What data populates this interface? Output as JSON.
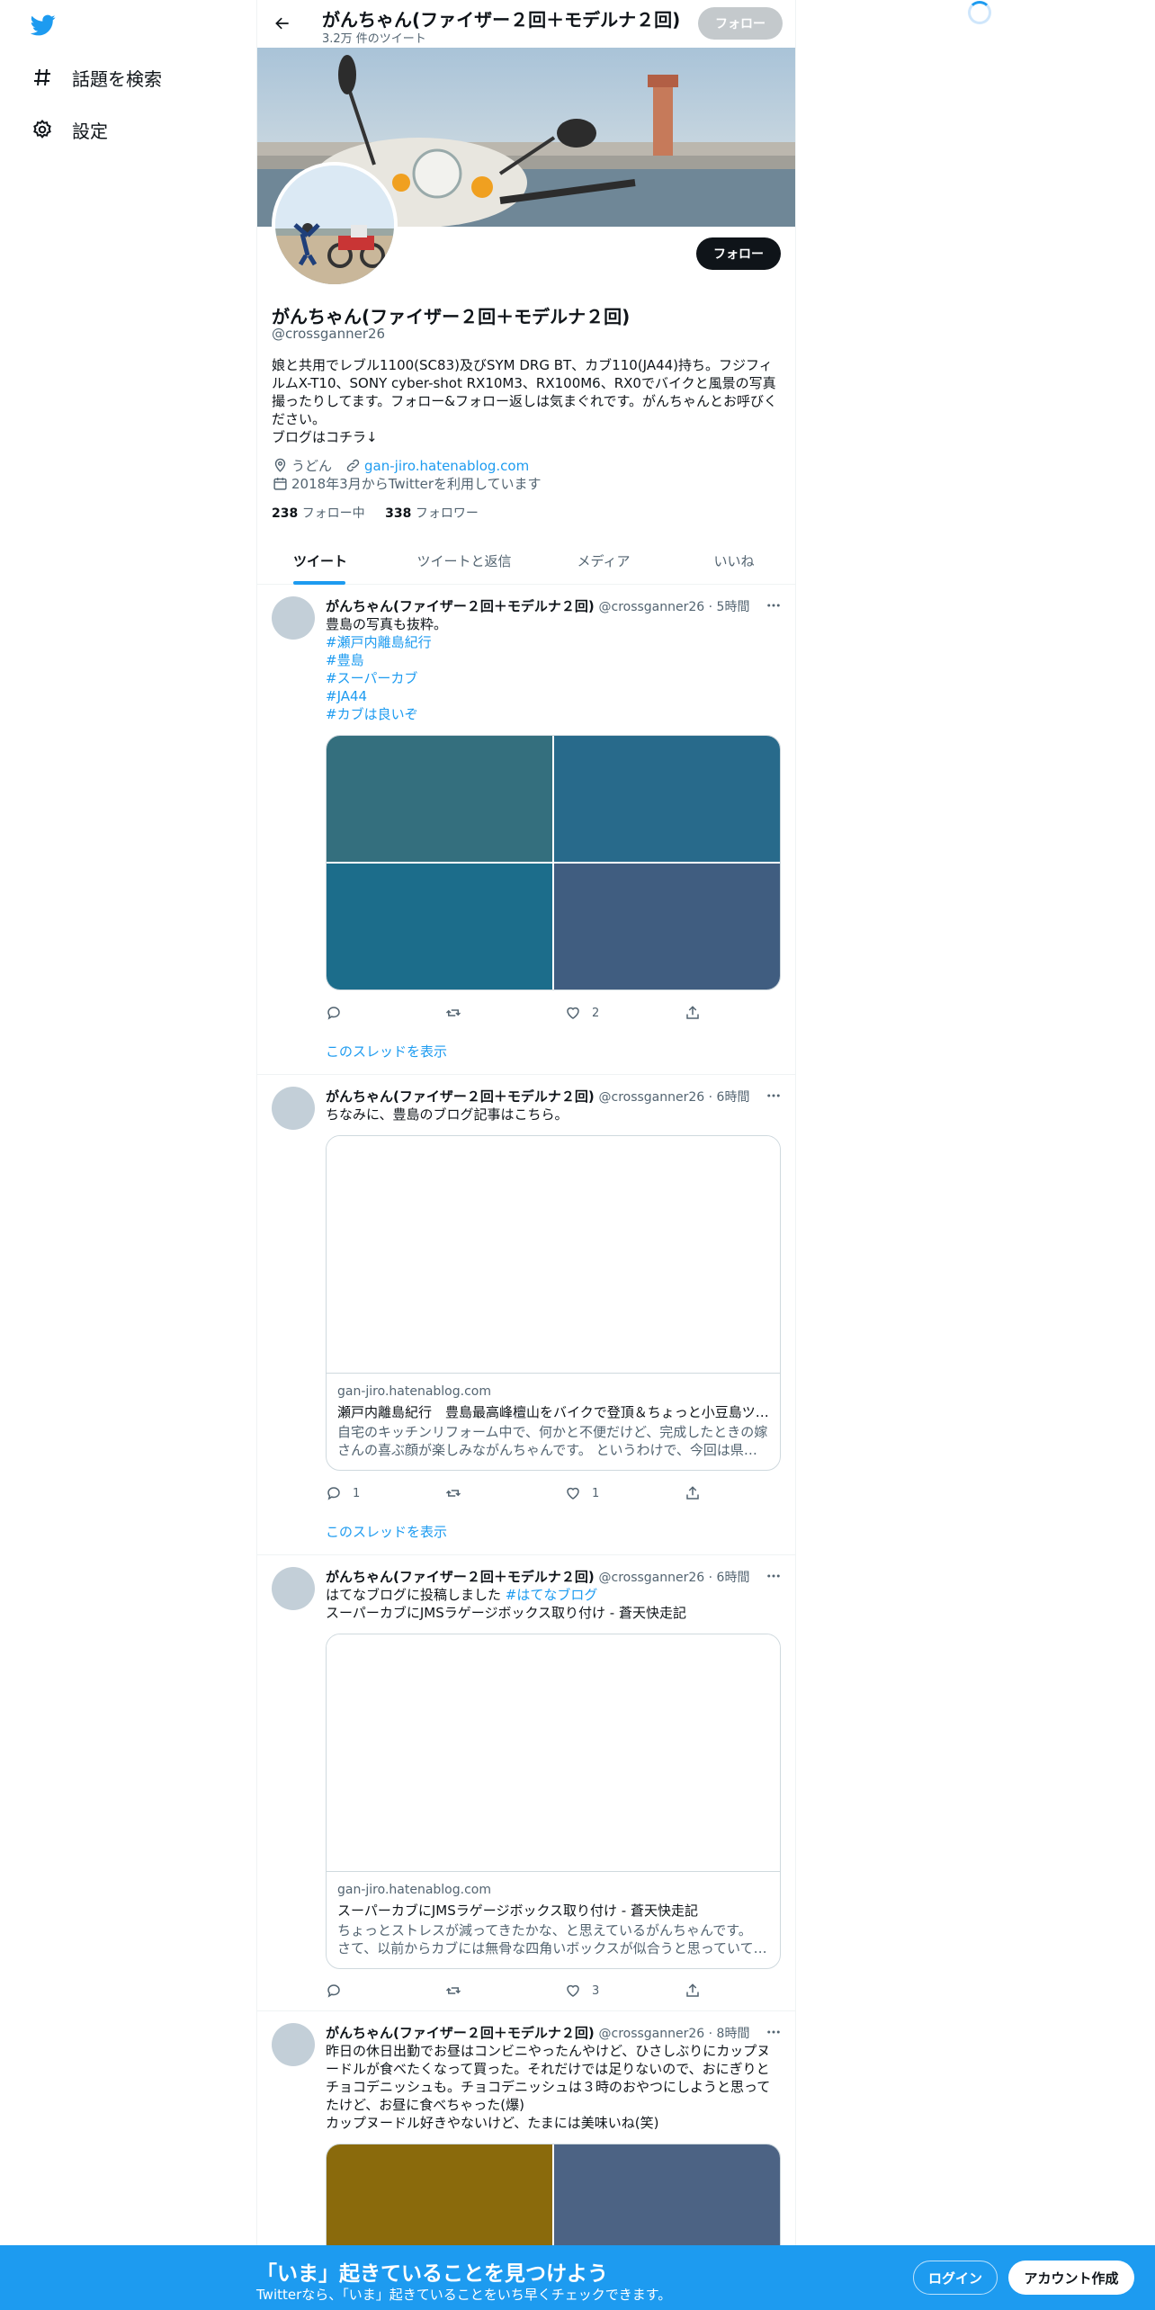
{
  "nav": {
    "explore_label": "話題を検索",
    "settings_label": "設定"
  },
  "colors": {
    "accent": "#1d9bf0",
    "text": "#0f1419",
    "muted": "#536471"
  },
  "header": {
    "name": "がんちゃん(ファイザー２回＋モデルナ２回)",
    "tweet_count": "3.2万 件のツイート",
    "follow_label": "フォロー"
  },
  "profile": {
    "name": "がんちゃん(ファイザー２回＋モデルナ２回)",
    "handle": "@crossganner26",
    "follow_label": "フォロー",
    "bio_line1": "娘と共用でレブル1100(SC83)及びSYM DRG BT、カブ110(JA44)持ち。フジフィルムX-T10、SONY  cyber-shot RX10M3、RX100M6、RX0でバイクと風景の写真撮ったりしてます。フォロー&フォロー返しは気まぐれです。がんちゃんとお呼びください。",
    "bio_line2": "ブログはコチラ↓",
    "location": "うどん",
    "website": "gan-jiro.hatenablog.com",
    "joined": "2018年3月からTwitterを利用しています",
    "following_count": "238",
    "following_label": "フォロー中",
    "followers_count": "338",
    "followers_label": "フォロワー"
  },
  "tabs": [
    {
      "label": "ツイート"
    },
    {
      "label": "ツイートと返信"
    },
    {
      "label": "メディア"
    },
    {
      "label": "いいね"
    }
  ],
  "tweets": [
    {
      "name": "がんちゃん(ファイザー２回＋モデルナ２回)",
      "handle": "@crossganner26 · 5時間",
      "text": "豊島の写真も抜粋。",
      "hashtags": [
        "#瀬戸内離島紀行",
        "#豊島",
        "#スーパーカブ",
        "#JA44",
        "#カブは良いぞ"
      ],
      "likes": "2",
      "thread": "このスレッドを表示"
    },
    {
      "name": "がんちゃん(ファイザー２回＋モデルナ２回)",
      "handle": "@crossganner26 · 6時間",
      "text": "ちなみに、豊島のブログ記事はこちら。",
      "card_domain": "gan-jiro.hatenablog.com",
      "card_title": "瀬戸内離島紀行　豊島最高峰檀山をバイクで登頂＆ちょっと小豆島ツーリング",
      "card_desc": "自宅のキッチンリフォーム中で、何かと不便だけど、完成したときの嫁さんの喜ぶ顔が楽しみながんちゃんです。 というわけで、今回は県…",
      "replies": "1",
      "likes": "1",
      "thread": "このスレッドを表示"
    },
    {
      "name": "がんちゃん(ファイザー２回＋モデルナ２回)",
      "handle": "@crossganner26 · 6時間",
      "text_pre": "はてなブログに投稿しました ",
      "text_tag": "#はてなブログ",
      "text_line2": "スーパーカブにJMSラゲージボックス取り付け - 蒼天快走記",
      "card_domain": "gan-jiro.hatenablog.com",
      "card_title": "スーパーカブにJMSラゲージボックス取り付け - 蒼天快走記",
      "card_desc": "ちょっとストレスが減ってきたかな、と思えているがんちゃんです。 さて、以前からカブには無骨な四角いボックスが似合うと思っていて…",
      "likes": "3"
    },
    {
      "name": "がんちゃん(ファイザー２回＋モデルナ２回)",
      "handle": "@crossganner26 · 8時間",
      "text": "昨日の休日出勤でお昼はコンビニやったんやけど、ひさしぶりにカップヌードルが食べたくなって買った。それだけでは足りないので、おにぎりとチョコデニッシュも。チョコデニッシュは３時のおやつにしようと思ってたけど、お昼に食べちゃった(爆)",
      "text_line2": "カップヌードル好きやないけど、たまには美味いね(笑)"
    }
  ],
  "bottom": {
    "title": "「いま」起きていることを見つけよう",
    "subtitle": "Twitterなら、「いま」起きていることをいち早くチェックできます。",
    "login_label": "ログイン",
    "signup_label": "アカウント作成"
  }
}
